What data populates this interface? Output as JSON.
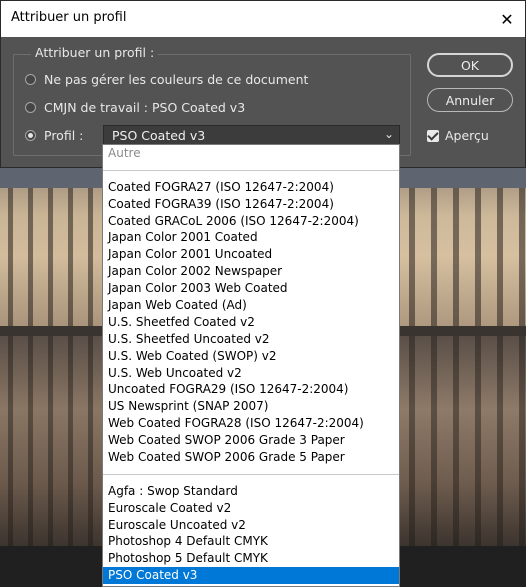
{
  "dialog": {
    "title": "Attribuer un profil",
    "group_label": "Attribuer un profil :",
    "options": [
      {
        "label": "Ne pas gérer les couleurs de ce document",
        "checked": false
      },
      {
        "label": "CMJN de travail :  PSO Coated v3",
        "checked": false
      },
      {
        "label": "Profil :",
        "checked": true
      }
    ],
    "profile_select": {
      "value": "PSO Coated v3"
    },
    "ok_label": "OK",
    "cancel_label": "Annuler",
    "preview_label": "Aperçu",
    "preview_checked": true
  },
  "dropdown": {
    "items": [
      {
        "label": "Autre",
        "type": "disabled"
      },
      {
        "label": "",
        "type": "separator"
      },
      {
        "label": "Coated FOGRA27 (ISO 12647-2:2004)",
        "type": "item"
      },
      {
        "label": "Coated FOGRA39 (ISO 12647-2:2004)",
        "type": "item"
      },
      {
        "label": "Coated GRACoL 2006 (ISO 12647-2:2004)",
        "type": "item"
      },
      {
        "label": "Japan Color 2001 Coated",
        "type": "item"
      },
      {
        "label": "Japan Color 2001 Uncoated",
        "type": "item"
      },
      {
        "label": "Japan Color 2002 Newspaper",
        "type": "item"
      },
      {
        "label": "Japan Color 2003 Web Coated",
        "type": "item"
      },
      {
        "label": "Japan Web Coated (Ad)",
        "type": "item"
      },
      {
        "label": "U.S. Sheetfed Coated v2",
        "type": "item"
      },
      {
        "label": "U.S. Sheetfed Uncoated v2",
        "type": "item"
      },
      {
        "label": "U.S. Web Coated (SWOP) v2",
        "type": "item"
      },
      {
        "label": "U.S. Web Uncoated v2",
        "type": "item"
      },
      {
        "label": "Uncoated FOGRA29 (ISO 12647-2:2004)",
        "type": "item"
      },
      {
        "label": "US Newsprint (SNAP 2007)",
        "type": "item"
      },
      {
        "label": "Web Coated FOGRA28 (ISO 12647-2:2004)",
        "type": "item"
      },
      {
        "label": "Web Coated SWOP 2006 Grade 3 Paper",
        "type": "item"
      },
      {
        "label": "Web Coated SWOP 2006 Grade 5 Paper",
        "type": "item"
      },
      {
        "label": "",
        "type": "separator"
      },
      {
        "label": "Agfa : Swop Standard",
        "type": "item"
      },
      {
        "label": "Euroscale Coated v2",
        "type": "item"
      },
      {
        "label": "Euroscale Uncoated v2",
        "type": "item"
      },
      {
        "label": "Photoshop 4 Default CMYK",
        "type": "item"
      },
      {
        "label": "Photoshop 5 Default CMYK",
        "type": "item"
      },
      {
        "label": "PSO Coated v3",
        "type": "selected"
      }
    ]
  },
  "colors": {
    "dialog_bg": "#535353",
    "selection": "#0078d7"
  },
  "icons": {
    "close": "close-icon",
    "chevron": "chevron-down-icon",
    "check": "checkmark-icon"
  }
}
